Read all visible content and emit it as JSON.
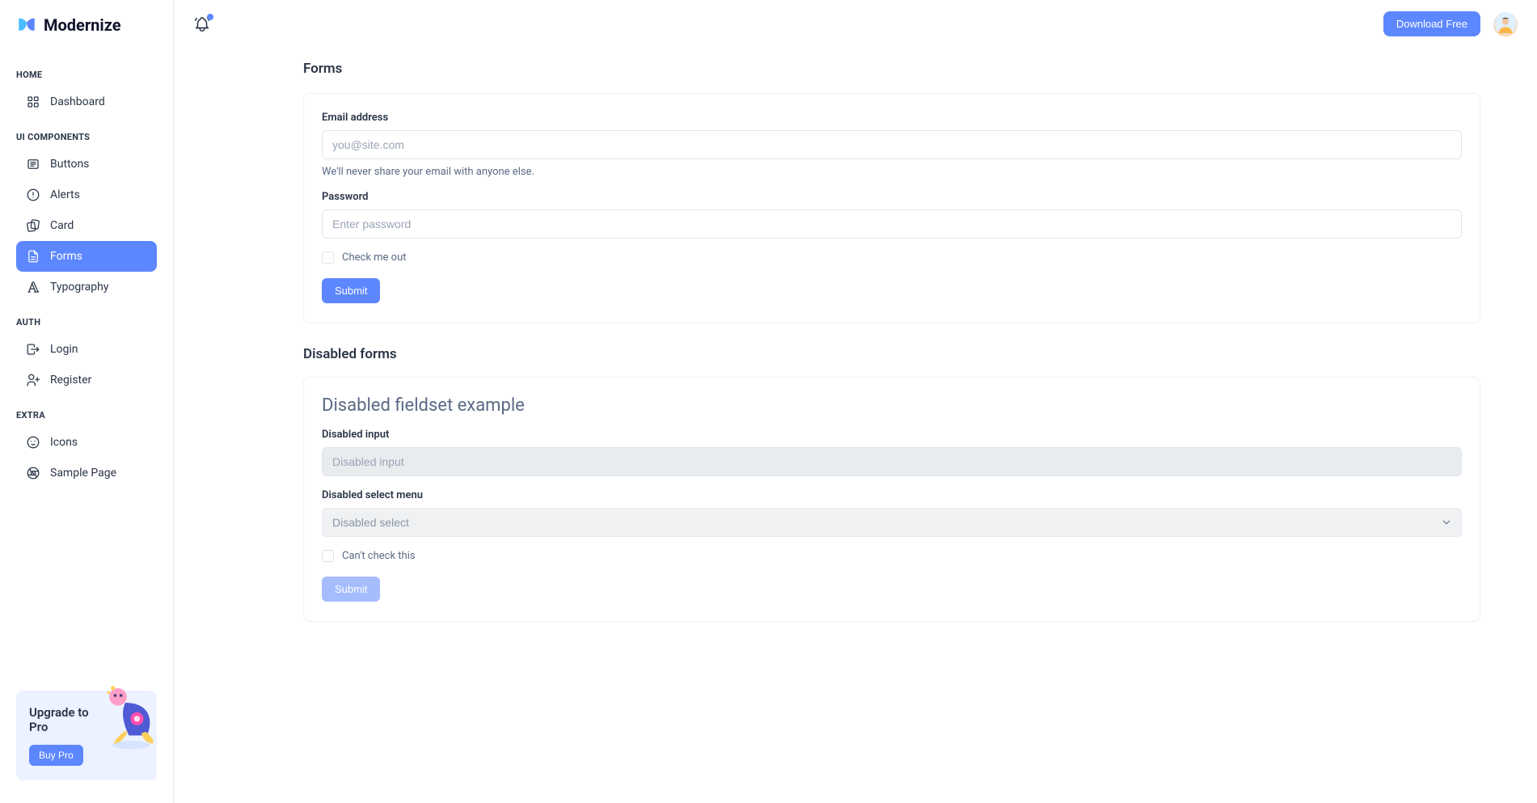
{
  "brand": {
    "name": "Modernize"
  },
  "header": {
    "download_label": "Download Free"
  },
  "sidebar": {
    "sections": {
      "home": "HOME",
      "ui": "UI COMPONENTS",
      "auth": "AUTH",
      "extra": "EXTRA"
    },
    "items": {
      "dashboard": "Dashboard",
      "buttons": "Buttons",
      "alerts": "Alerts",
      "card": "Card",
      "forms": "Forms",
      "typography": "Typography",
      "login": "Login",
      "register": "Register",
      "icons": "Icons",
      "sample": "Sample Page"
    },
    "upgrade": {
      "title": "Upgrade to Pro",
      "button": "Buy Pro"
    }
  },
  "main": {
    "forms": {
      "title": "Forms",
      "email_label": "Email address",
      "email_placeholder": "you@site.com",
      "email_help": "We'll never share your email with anyone else.",
      "password_label": "Password",
      "password_placeholder": "Enter password",
      "check_label": "Check me out",
      "submit": "Submit"
    },
    "disabled": {
      "title": "Disabled forms",
      "legend": "Disabled fieldset example",
      "input_label": "Disabled input",
      "input_placeholder": "Disabled input",
      "select_label": "Disabled select menu",
      "select_value": "Disabled select",
      "check_label": "Can't check this",
      "submit": "Submit"
    }
  }
}
